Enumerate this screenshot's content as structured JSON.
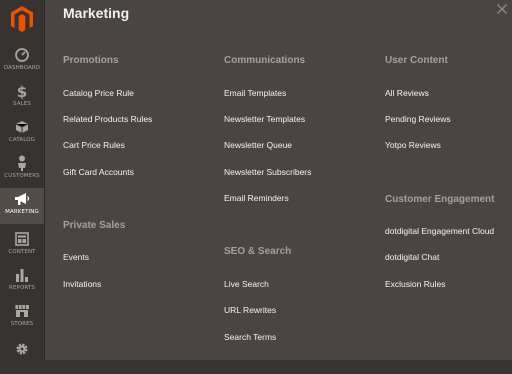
{
  "sidebar": {
    "items": [
      {
        "label": "DASHBOARD",
        "icon": "dashboard-icon"
      },
      {
        "label": "SALES",
        "icon": "dollar-icon"
      },
      {
        "label": "CATALOG",
        "icon": "cube-icon"
      },
      {
        "label": "CUSTOMERS",
        "icon": "person-icon"
      },
      {
        "label": "MARKETING",
        "icon": "megaphone-icon",
        "active": true
      },
      {
        "label": "CONTENT",
        "icon": "content-icon"
      },
      {
        "label": "REPORTS",
        "icon": "bar-chart-icon"
      },
      {
        "label": "STORES",
        "icon": "storefront-icon"
      },
      {
        "label": "",
        "icon": "gear-icon"
      }
    ]
  },
  "panel": {
    "title": "Marketing",
    "close_icon": "close-icon",
    "promotions": {
      "heading": "Promotions",
      "links": [
        "Catalog Price Rule",
        "Related Products Rules",
        "Cart Price Rules",
        "Gift Card Accounts"
      ]
    },
    "private_sales": {
      "heading": "Private Sales",
      "links": [
        "Events",
        "Invitations"
      ]
    },
    "communications": {
      "heading": "Communications",
      "links": [
        "Email Templates",
        "Newsletter Templates",
        "Newsletter Queue",
        "Newsletter Subscribers",
        "Email Reminders"
      ]
    },
    "seo_search": {
      "heading": "SEO & Search",
      "links": [
        "Live Search",
        "URL Rewrites",
        "Search Terms"
      ]
    },
    "user_content": {
      "heading": "User Content",
      "links": [
        "All Reviews",
        "Pending Reviews",
        "Yotpo Reviews"
      ]
    },
    "customer_engagement": {
      "heading": "Customer Engagement",
      "links": [
        "dotdigital Engagement Cloud",
        "dotdigital Chat",
        "Exclusion Rules"
      ]
    }
  },
  "colors": {
    "sidebar_bg": "#373330",
    "panel_bg": "#4a4542",
    "active_bg": "#524d49",
    "logo": "#eb5202",
    "heading": "#a6a09b",
    "link": "#f7f3eb"
  }
}
